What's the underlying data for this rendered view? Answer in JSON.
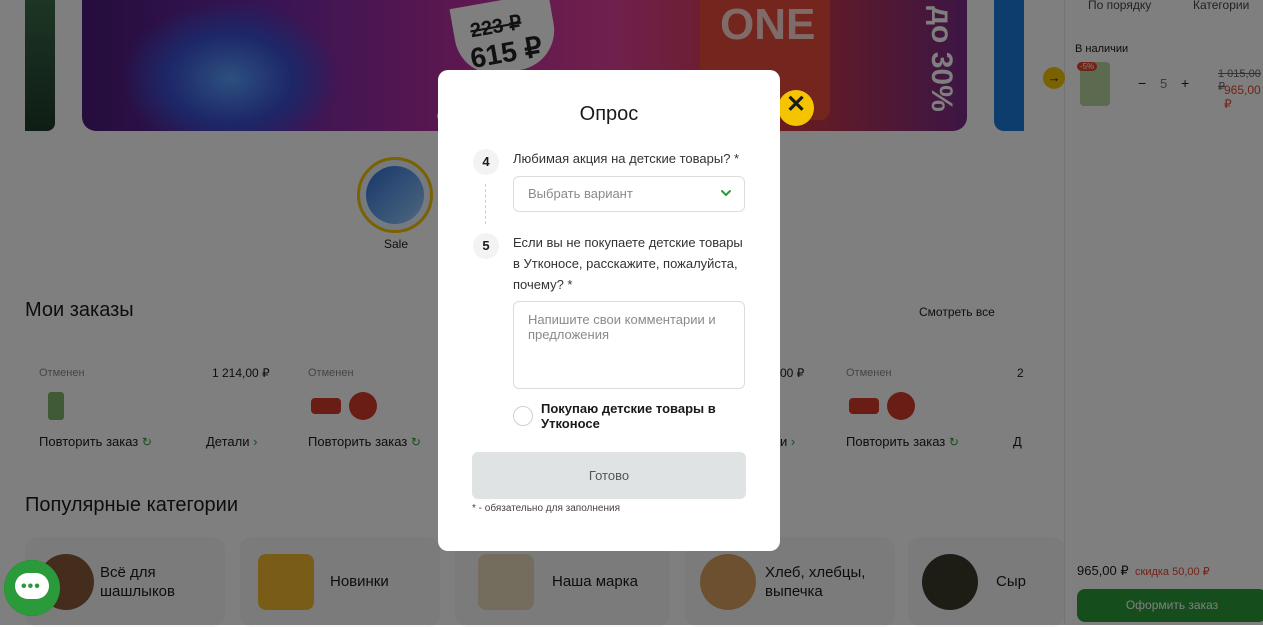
{
  "banner": {
    "price_old": "223 ₽",
    "price_new": "615 ₽",
    "pack_text": "ONE",
    "side_text": "до 30%"
  },
  "stories": [
    {
      "label": "Sale"
    }
  ],
  "orders_section": {
    "title": "Мои заказы",
    "see_all": "Смотреть все",
    "orders": [
      {
        "status": "Отменен",
        "sum": "1 214,00 ₽",
        "repeat": "Повторить заказ",
        "details": "Детали"
      },
      {
        "status": "Отменен",
        "sum": "",
        "repeat": "Повторить заказ",
        "details": ""
      },
      {
        "status": "",
        "sum": "00 ₽",
        "repeat": "",
        "details": "и"
      },
      {
        "status": "Отменен",
        "sum": "2",
        "repeat": "Повторить заказ",
        "details": "Д"
      }
    ]
  },
  "categories_section": {
    "title": "Популярные категории",
    "items": [
      {
        "label": "Всё для\nшашлыков"
      },
      {
        "label": "Новинки"
      },
      {
        "label": "Наша марка"
      },
      {
        "label": "Хлеб, хлебцы,\nвыпечка"
      },
      {
        "label": "Сыр"
      }
    ]
  },
  "cart": {
    "tabs": [
      "По порядку",
      "Категории"
    ],
    "section": "В наличии",
    "badge": "-5%",
    "qty": "5",
    "minus": "−",
    "plus": "+",
    "price_old": "1 015,00 ₽",
    "price_new": "965,00 ₽",
    "total": "965,00 ₽",
    "discount": "скидка 50,00 ₽",
    "checkout": "Оформить заказ",
    "arrow": "→"
  },
  "survey": {
    "title": "Опрос",
    "close": "✕",
    "q4": {
      "num": "4",
      "text": "Любимая акция на детские товары? *",
      "placeholder": "Выбрать вариант"
    },
    "q5": {
      "num": "5",
      "text": "Если вы не покупаете детские товары в Утконосе, расскажите, пожалуйста, почему? *",
      "placeholder": "Напишите свои комментарии и предложения"
    },
    "checkbox_label": "Покупаю детские товары в Утконосе",
    "submit": "Готово",
    "footnote": "* - обязательно для заполнения"
  },
  "icons": {
    "chat": "chat-icon",
    "close": "close-icon",
    "chevron": "chevron-down-icon",
    "refresh": "↻",
    "arrow_right": "›"
  },
  "colors": {
    "accent_green": "#2a9a3a",
    "accent_yellow": "#f5c400",
    "sale_red": "#e5462d"
  }
}
